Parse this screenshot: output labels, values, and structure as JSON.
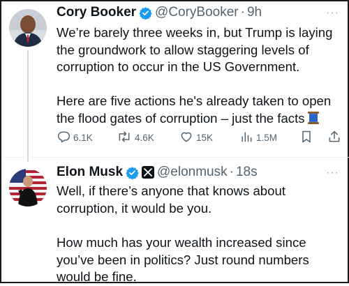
{
  "tweets": [
    {
      "author_name": "Cory Booker",
      "handle": "@CoryBooker",
      "separator": "·",
      "time": "9h",
      "text_paragraph_1": "We’re barely three weeks in, but Trump is laying the groundwork to allow staggering levels of corruption to occur in the US Government.",
      "text_paragraph_2": "Here are five actions he's already taken to open the flood gates of corruption – just the facts",
      "emoji_icon": "thread-spool-icon",
      "actions": {
        "replies": "6.1K",
        "reposts": "4.6K",
        "likes": "15K",
        "views": "1.5M"
      },
      "more_label": "···"
    },
    {
      "author_name": "Elon Musk",
      "handle": "@elonmusk",
      "separator": "·",
      "time": "18s",
      "text_paragraph_1": "Well, if there’s anyone that knows about corruption, it would be you.",
      "text_paragraph_2": "How much has your wealth increased since you’ve been in politics? Just round numbers would be fine.",
      "more_label": "···"
    }
  ],
  "colors": {
    "verified": "#1d9bf0",
    "text_primary": "#0f1419",
    "text_secondary": "#536471",
    "thread_line": "#cfd9de"
  }
}
